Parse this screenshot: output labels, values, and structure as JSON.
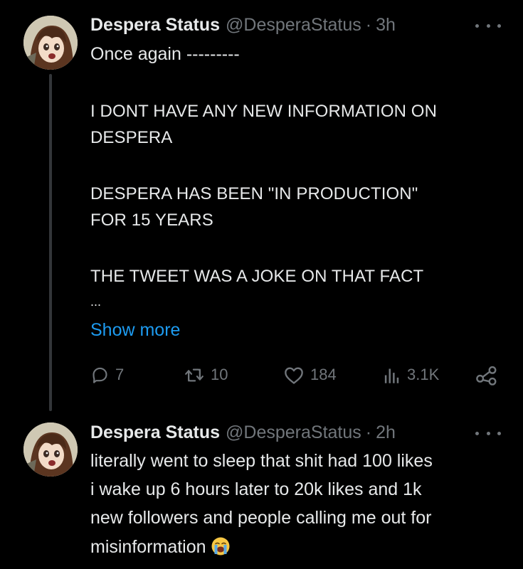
{
  "tweets": [
    {
      "display_name": "Despera Status",
      "handle": "@DesperaStatus",
      "separator": "·",
      "time": "3h",
      "lines": [
        "Once again ---------",
        "I DONT HAVE ANY NEW INFORMATION ON",
        "DESPERA",
        "DESPERA HAS BEEN \"IN PRODUCTION\"",
        "FOR 15 YEARS",
        "THE TWEET WAS A JOKE ON THAT FACT",
        "..."
      ],
      "show_more": "Show more",
      "stats": {
        "replies": "7",
        "retweets": "10",
        "likes": "184",
        "views": "3.1K"
      }
    },
    {
      "display_name": "Despera Status",
      "handle": "@DesperaStatus",
      "separator": "·",
      "time": "2h",
      "lines": [
        "literally went to sleep that shit had 100 likes",
        "i wake up 6 hours later to 20k likes and 1k",
        "new followers and people calling me out for",
        "misinformation"
      ],
      "emoji": "loudly-crying-face"
    }
  ],
  "icons": {
    "reply": "reply-icon",
    "retweet": "retweet-icon",
    "like": "heart-icon",
    "views": "views-icon",
    "share": "share-icon",
    "more": "more-options-icon"
  },
  "colors": {
    "background": "#000000",
    "text": "#e7e9ea",
    "muted": "#71767b",
    "link": "#1d9bf0",
    "thread_line": "#333639"
  }
}
